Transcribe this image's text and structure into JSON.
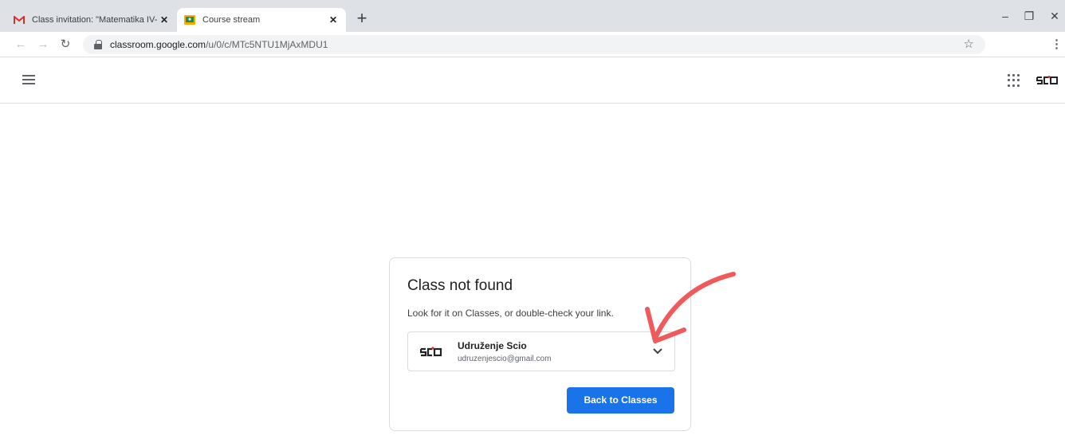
{
  "browser": {
    "tabs": [
      {
        "title": "Class invitation: \"Matematika IV-",
        "icon": "gmail-icon",
        "active": false
      },
      {
        "title": "Course stream",
        "icon": "classroom-icon",
        "active": true
      }
    ],
    "new_tab": "+",
    "url_host": "classroom.google.com",
    "url_path": "/u/0/c/MTc5NTU1MjAxMDU1"
  },
  "dialog": {
    "title": "Class not found",
    "message": "Look for it on Classes, or double-check your link.",
    "account": {
      "name": "Udruženje Scio",
      "email": "udruzenjescio@gmail.com"
    },
    "back_button": "Back to Classes"
  },
  "colors": {
    "primary": "#1a73e8",
    "annotation_arrow": "#f05a5a"
  }
}
